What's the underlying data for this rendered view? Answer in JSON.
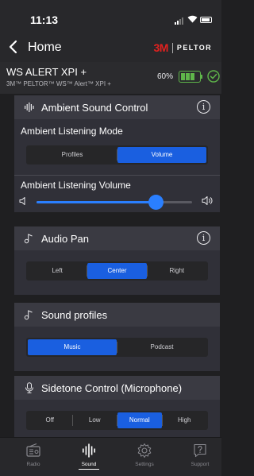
{
  "status": {
    "time": "11:13"
  },
  "nav": {
    "title": "Home",
    "brand_mark": "3M",
    "brand_name": "PELTOR"
  },
  "device": {
    "name": "WS ALERT XPI +",
    "subtitle": "3M™ PELTOR™ WS™ Alert™ XPI +",
    "battery_percent": "60%",
    "battery_level": 0.6,
    "connected": true
  },
  "ambient": {
    "title": "Ambient Sound Control",
    "mode_label": "Ambient Listening Mode",
    "mode_options": [
      "Profiles",
      "Volume"
    ],
    "mode_selected": "Volume",
    "volume_label": "Ambient Listening Volume",
    "volume_level": 0.77
  },
  "audio_pan": {
    "title": "Audio Pan",
    "options": [
      "Left",
      "Center",
      "Right"
    ],
    "selected": "Center"
  },
  "sound_profiles": {
    "title": "Sound profiles",
    "options": [
      "Music",
      "Podcast"
    ],
    "selected": "Music"
  },
  "sidetone": {
    "title": "Sidetone Control (Microphone)",
    "options": [
      "Off",
      "Low",
      "Normal",
      "High"
    ],
    "selected": "Normal"
  },
  "tabs": [
    {
      "label": "Radio",
      "icon": "radio-icon",
      "active": false
    },
    {
      "label": "Sound",
      "icon": "sound-icon",
      "active": true
    },
    {
      "label": "Settings",
      "icon": "settings-gear-icon",
      "active": false
    },
    {
      "label": "Support",
      "icon": "support-icon",
      "active": false
    }
  ],
  "colors": {
    "accent": "#1a5fe0",
    "slider": "#2a7fff",
    "battery": "#5fb64a",
    "brand_red": "#e3211f"
  }
}
